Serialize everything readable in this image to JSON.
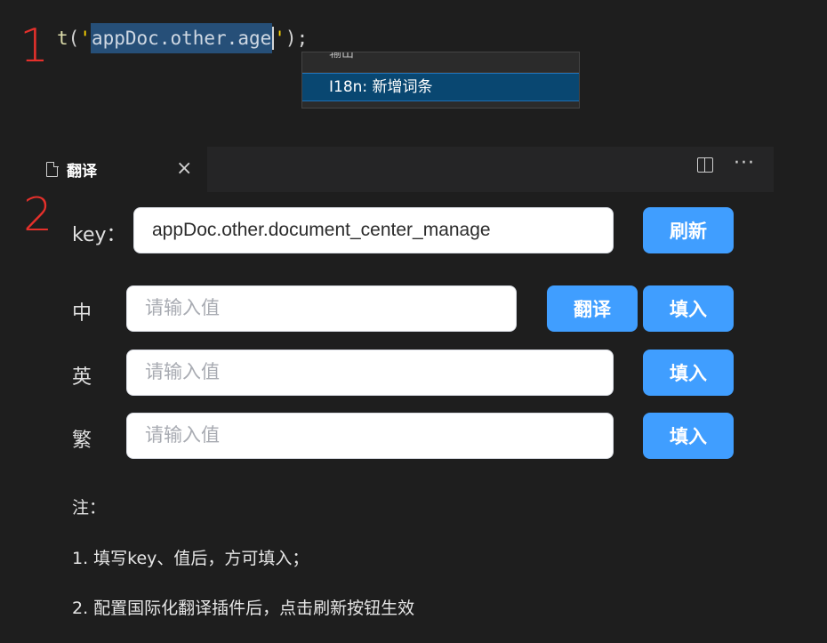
{
  "markers": {
    "step1": "1",
    "step2": "2"
  },
  "code": {
    "fn": "t",
    "open": "(",
    "quote_open": "'",
    "key": "appDoc.other.age",
    "quote_close": "'",
    "close": ");"
  },
  "suggest": {
    "cut_text": "输出",
    "item": "I18n: 新增词条"
  },
  "tab": {
    "title": "翻译",
    "close_glyph": "×",
    "more_glyph": "···"
  },
  "form": {
    "key_label": "key：",
    "key_value": "appDoc.other.document_center_manage",
    "refresh_label": "刷新",
    "rows": [
      {
        "label": "中",
        "placeholder": "请输入值",
        "translate_label": "翻译",
        "fill_label": "填入"
      },
      {
        "label": "英",
        "placeholder": "请输入值",
        "fill_label": "填入"
      },
      {
        "label": "繁",
        "placeholder": "请输入值",
        "fill_label": "填入"
      }
    ]
  },
  "notes": {
    "title": "注：",
    "line1": "1. 填写key、值后，方可填入；",
    "line2": "2. 配置国际化翻译插件后，点击刷新按钮生效"
  },
  "colors": {
    "accent": "#409eff",
    "marker": "#e5302b",
    "selection": "#264f78"
  }
}
